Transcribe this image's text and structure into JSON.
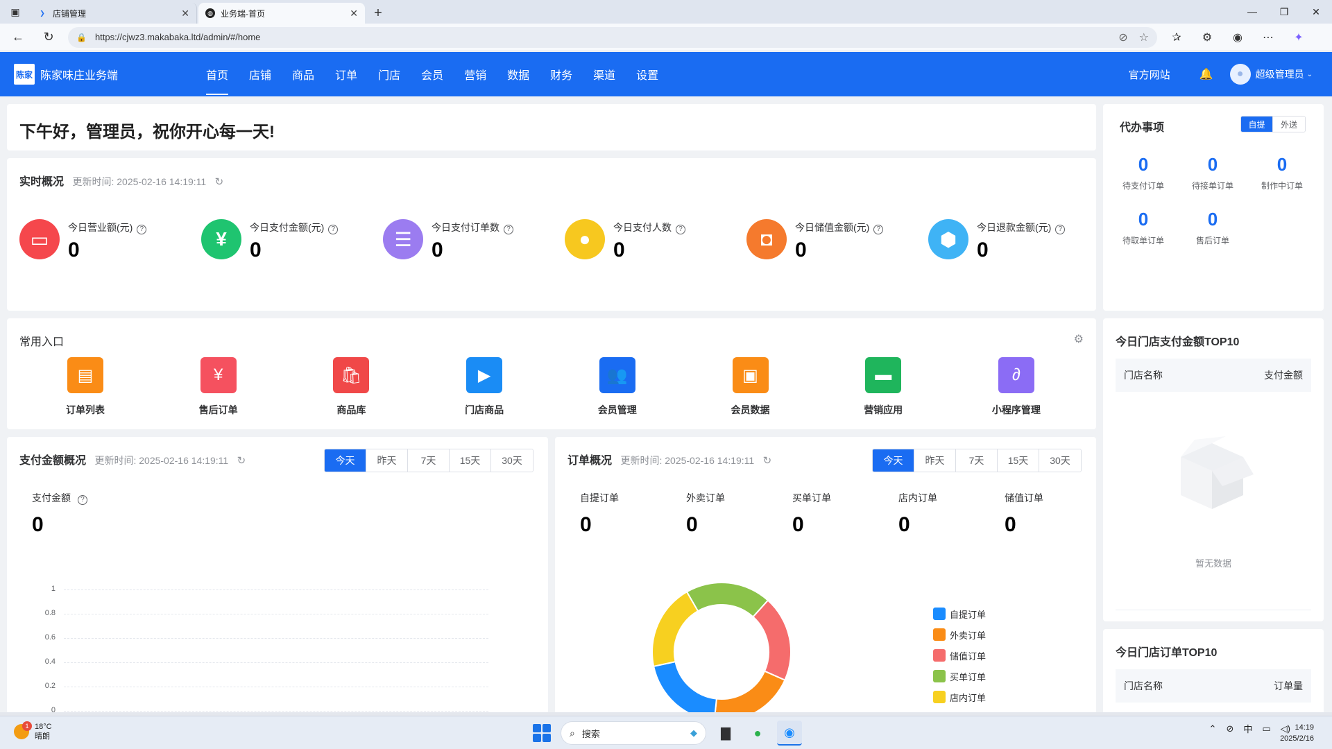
{
  "browser": {
    "tabs": [
      {
        "title": "店铺管理",
        "active": false
      },
      {
        "title": "业务端-首页",
        "active": true
      }
    ],
    "url": "https://cjwz3.makabaka.ltd/admin/#/home"
  },
  "header": {
    "brand": "陈家味庄业务端",
    "logo_text": "陈家",
    "nav": [
      "首页",
      "店铺",
      "商品",
      "订单",
      "门店",
      "会员",
      "营销",
      "数据",
      "财务",
      "渠道",
      "设置"
    ],
    "active_nav": 0,
    "official_site": "官方网站",
    "user": "超级管理员"
  },
  "greeting": "下午好，管理员，祝你开心每一天!",
  "realtime": {
    "title": "实时概况",
    "update_time": "更新时间:  2025-02-16 14:19:11",
    "stats": [
      {
        "label": "今日营业额(元)",
        "value": "0",
        "color": "#f5474c",
        "icon": "store-icon",
        "glyph": "▭"
      },
      {
        "label": "今日支付金额(元)",
        "value": "0",
        "color": "#1fc470",
        "icon": "yuan-icon",
        "glyph": "¥"
      },
      {
        "label": "今日支付订单数",
        "value": "0",
        "color": "#9b7cf0",
        "icon": "document-icon",
        "glyph": "☰"
      },
      {
        "label": "今日支付人数",
        "value": "0",
        "color": "#f7c81f",
        "icon": "user-icon",
        "glyph": "●"
      },
      {
        "label": "今日储值金额(元)",
        "value": "0",
        "color": "#f57a2d",
        "icon": "bag-icon",
        "glyph": "◘"
      },
      {
        "label": "今日退款金额(元)",
        "value": "0",
        "color": "#3fb3f5",
        "icon": "shield-icon",
        "glyph": "⬢"
      }
    ]
  },
  "todo": {
    "title": "代办事项",
    "toggle": [
      "自提",
      "外送"
    ],
    "items": [
      {
        "value": "0",
        "label": "待支付订单"
      },
      {
        "value": "0",
        "label": "待接单订单"
      },
      {
        "value": "0",
        "label": "制作中订单"
      },
      {
        "value": "0",
        "label": "待取单订单"
      },
      {
        "value": "0",
        "label": "售后订单"
      }
    ]
  },
  "shortcuts": {
    "title": "常用入口",
    "items": [
      {
        "label": "订单列表",
        "color": "#fa8c16",
        "icon": "order-list-icon",
        "glyph": "▤"
      },
      {
        "label": "售后订单",
        "color": "#f5515f",
        "icon": "after-sale-icon",
        "glyph": "¥"
      },
      {
        "label": "商品库",
        "color": "#f04848",
        "icon": "shopping-bag-icon",
        "glyph": "🛍"
      },
      {
        "label": "门店商品",
        "color": "#1a8cf5",
        "icon": "video-icon",
        "glyph": "▶"
      },
      {
        "label": "会员管理",
        "color": "#1a6cf2",
        "icon": "members-icon",
        "glyph": "👥"
      },
      {
        "label": "会员数据",
        "color": "#fa8c16",
        "icon": "member-data-icon",
        "glyph": "▣"
      },
      {
        "label": "营销应用",
        "color": "#1fb55c",
        "icon": "ticket-icon",
        "glyph": "▬"
      },
      {
        "label": "小程序管理",
        "color": "#8b6cf5",
        "icon": "mini-program-icon",
        "glyph": "∂"
      }
    ]
  },
  "pay_overview": {
    "title": "支付金额概况",
    "update_time": "更新时间:  2025-02-16 14:19:11",
    "periods": [
      "今天",
      "昨天",
      "7天",
      "15天",
      "30天"
    ],
    "active_period": 0,
    "metric_label": "支付金额",
    "metric_value": "0"
  },
  "order_overview": {
    "title": "订单概况",
    "update_time": "更新时间:  2025-02-16 14:19:11",
    "periods": [
      "今天",
      "昨天",
      "7天",
      "15天",
      "30天"
    ],
    "active_period": 0,
    "stats": [
      {
        "label": "自提订单",
        "value": "0"
      },
      {
        "label": "外卖订单",
        "value": "0"
      },
      {
        "label": "买单订单",
        "value": "0"
      },
      {
        "label": "店内订单",
        "value": "0"
      },
      {
        "label": "储值订单",
        "value": "0"
      }
    ]
  },
  "chart_data": [
    {
      "type": "line",
      "title": "",
      "xlabel": "",
      "ylabel": "",
      "y_ticks": [
        "1",
        "0.8",
        "0.6",
        "0.4",
        "0.2",
        "0"
      ],
      "ylim": [
        0,
        1
      ],
      "grid": true,
      "series": []
    },
    {
      "type": "pie",
      "donut": true,
      "legend_position": "right",
      "slices": [
        {
          "name": "自提订单",
          "value": 1,
          "color": "#1a8cff"
        },
        {
          "name": "外卖订单",
          "value": 1,
          "color": "#fa8c16"
        },
        {
          "name": "储值订单",
          "value": 1,
          "color": "#f56c6c"
        },
        {
          "name": "买单订单",
          "value": 1,
          "color": "#8bc34a"
        },
        {
          "name": "店内订单",
          "value": 1,
          "color": "#f7d020"
        }
      ]
    }
  ],
  "top10_pay": {
    "title": "今日门店支付金额TOP10",
    "col_name": "门店名称",
    "col_value": "支付金额",
    "empty": "暂无数据"
  },
  "top10_order": {
    "title": "今日门店订单TOP10",
    "col_name": "门店名称",
    "col_value": "订单量"
  },
  "taskbar": {
    "temperature": "18°C",
    "weather": "晴朗",
    "weather_badge": "1",
    "search": "搜索",
    "ime": "中",
    "time": "14:19",
    "date": "2025/2/16"
  }
}
